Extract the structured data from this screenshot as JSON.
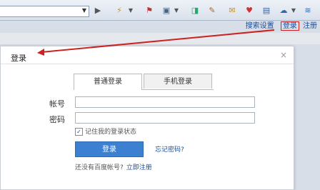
{
  "toolbar": {
    "dropdown": "▼",
    "icons": [
      "▶",
      "⚡",
      "▼",
      "⚑",
      "▣",
      "▼",
      "◨",
      "✎",
      "✉",
      "♥",
      "▤",
      "☁",
      "▼",
      "≋"
    ]
  },
  "top_links": {
    "search_settings": "搜索设置",
    "login": "登录",
    "register": "注册"
  },
  "dialog": {
    "title": "登录",
    "close": "×",
    "tabs": [
      "普通登录",
      "手机登录"
    ],
    "username_label": "帐号",
    "password_label": "密码",
    "remember": "记住我的登录状态",
    "login_button": "登录",
    "forgot": "忘记密码?",
    "no_account": "还没有百度帐号?",
    "register": "立即注册"
  },
  "colors": {
    "arrow": "#cc2222",
    "accent": "#3c80d1",
    "link": "#1b4f9c"
  }
}
